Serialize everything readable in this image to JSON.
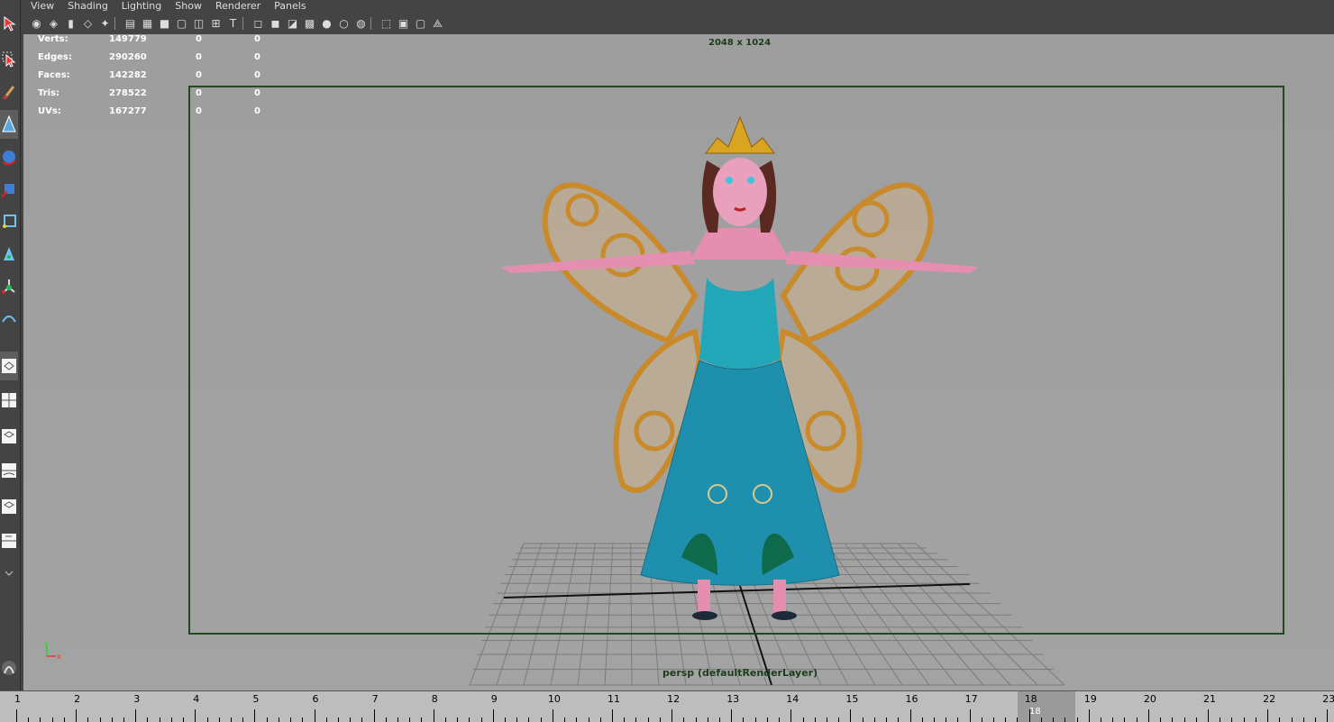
{
  "menu": {
    "items": [
      "View",
      "Shading",
      "Lighting",
      "Show",
      "Renderer",
      "Panels"
    ]
  },
  "toolbar": {
    "icons": [
      "camera-select-icon",
      "camera-attributes-icon",
      "bookmark-icon",
      "image-plane-icon",
      "2d-pan-zoom-icon",
      "grid-icon",
      "film-gate-icon",
      "resolution-gate-icon",
      "gate-mask-icon",
      "field-chart-icon",
      "safe-action-icon",
      "safe-title-icon",
      "wireframe-icon",
      "smooth-shade-icon",
      "wireframe-on-shaded-icon",
      "textured-icon",
      "default-lighting-icon",
      "all-lights-icon",
      "shadows-icon",
      "isolate-select-icon",
      "xray-icon",
      "xray-joints-icon",
      "xray-components-icon"
    ]
  },
  "hud": {
    "rows": [
      {
        "label": "Verts:",
        "value": "149779",
        "sel": "0",
        "tri": "0"
      },
      {
        "label": "Edges:",
        "value": "290260",
        "sel": "0",
        "tri": "0"
      },
      {
        "label": "Faces:",
        "value": "142282",
        "sel": "0",
        "tri": "0"
      },
      {
        "label": "Tris:",
        "value": "278522",
        "sel": "0",
        "tri": "0"
      },
      {
        "label": "UVs:",
        "value": "167277",
        "sel": "0",
        "tri": "0"
      }
    ]
  },
  "viewport": {
    "resolution": "2048 x 1024",
    "camera_label": "persp (defaultRenderLayer)",
    "axis": {
      "y": "y",
      "x": "x"
    }
  },
  "timeline": {
    "frames": [
      "1",
      "2",
      "3",
      "4",
      "5",
      "6",
      "7",
      "8",
      "9",
      "10",
      "11",
      "12",
      "13",
      "14",
      "15",
      "16",
      "17",
      "18",
      "19",
      "20",
      "21",
      "22",
      "23"
    ],
    "current_frame": "18"
  },
  "colors": {
    "viewport_bg": "#a0a0a0",
    "gate_border": "#1f4a1f",
    "dress": "#1f8fae",
    "wings": "#c88a2a",
    "skin": "#e48fb0"
  }
}
